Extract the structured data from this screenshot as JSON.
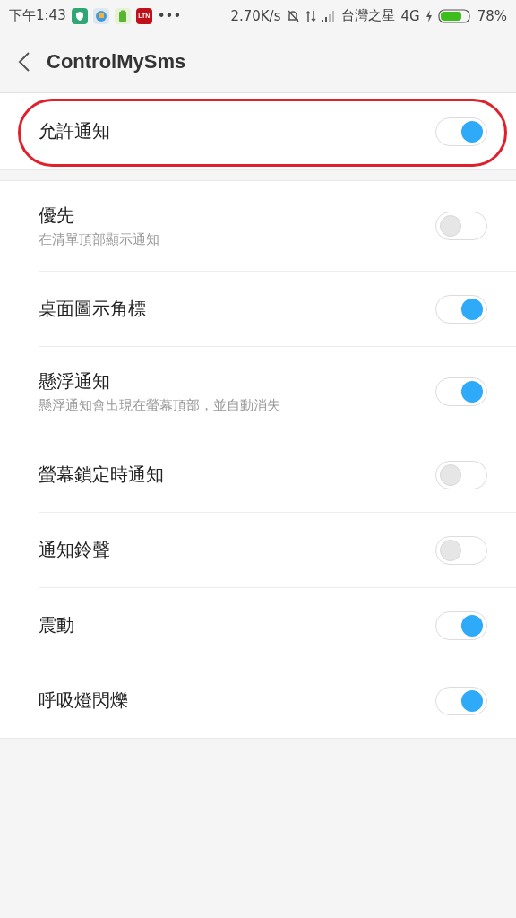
{
  "status_bar": {
    "time": "下午1:43",
    "app_icons": [
      {
        "kind": "shield"
      },
      {
        "kind": "browser"
      },
      {
        "kind": "battery-app"
      },
      {
        "kind": "news",
        "label": "LTN"
      }
    ],
    "more": "•••",
    "speed": "2.70K/s",
    "carrier": "台灣之星",
    "network": "4G",
    "battery": "78%"
  },
  "header": {
    "title": "ControlMySms"
  },
  "main_setting": {
    "label": "允許通知",
    "on": true,
    "highlighted": true
  },
  "settings": [
    {
      "label": "優先",
      "subtitle": "在清單頂部顯示通知",
      "on": false
    },
    {
      "label": "桌面圖示角標",
      "on": true
    },
    {
      "label": "懸浮通知",
      "subtitle": "懸浮通知會出現在螢幕頂部，並自動消失",
      "on": true
    },
    {
      "label": "螢幕鎖定時通知",
      "on": false
    },
    {
      "label": "通知鈴聲",
      "on": false
    },
    {
      "label": "震動",
      "on": true
    },
    {
      "label": "呼吸燈閃爍",
      "on": true
    }
  ]
}
